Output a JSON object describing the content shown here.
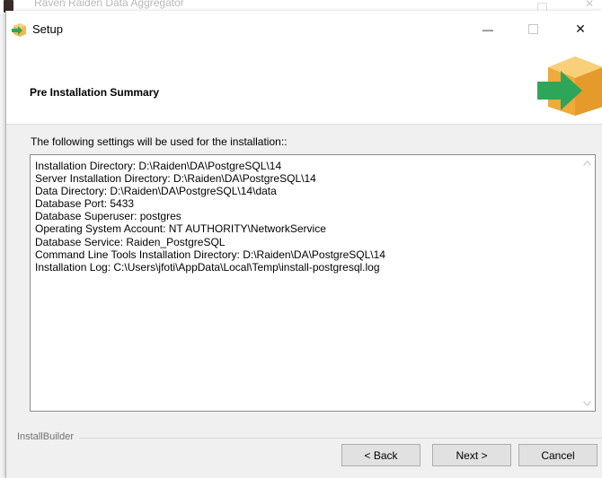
{
  "background_window": {
    "title": "Raven Raiden Data Aggregator"
  },
  "dialog": {
    "title": "Setup",
    "controls": {
      "minimize": "—",
      "close": "✕"
    }
  },
  "header": {
    "title": "Pre Installation Summary"
  },
  "content": {
    "caption": "The following settings will be used for the installation::",
    "summary_lines": [
      "Installation Directory: D:\\Raiden\\DA\\PostgreSQL\\14",
      "Server Installation Directory: D:\\Raiden\\DA\\PostgreSQL\\14",
      "Data Directory: D:\\Raiden\\DA\\PostgreSQL\\14\\data",
      "Database Port: 5433",
      "Database Superuser: postgres",
      "Operating System Account: NT AUTHORITY\\NetworkService",
      "Database Service: Raiden_PostgreSQL",
      "Command Line Tools Installation Directory: D:\\Raiden\\DA\\PostgreSQL\\14",
      "Installation Log: C:\\Users\\jfoti\\AppData\\Local\\Temp\\install-postgresql.log"
    ]
  },
  "footer": {
    "brand": "InstallBuilder",
    "buttons": {
      "back": "< Back",
      "next": "Next >",
      "cancel": "Cancel"
    }
  },
  "icons": {
    "setup": "box-arrow-icon",
    "header_logo": "box-arrow-icon"
  },
  "colors": {
    "box": "#f5b84a",
    "arrow": "#2ea65a",
    "dialog_bg": "#f0f0f0"
  }
}
